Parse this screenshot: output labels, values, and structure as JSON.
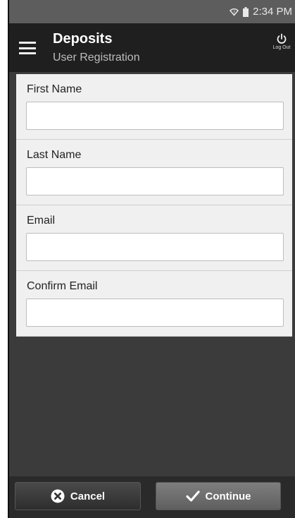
{
  "status_bar": {
    "time": "2:34 PM",
    "icons": [
      "wifi-icon",
      "battery-icon"
    ]
  },
  "app_bar": {
    "title": "Deposits",
    "subtitle": "User Registration",
    "menu_icon": "hamburger-menu-icon",
    "logout_label": "Log Out",
    "logout_icon": "power-icon"
  },
  "form": {
    "fields": [
      {
        "label": "First Name",
        "value": "",
        "placeholder": ""
      },
      {
        "label": "Last Name",
        "value": "",
        "placeholder": ""
      },
      {
        "label": "Email",
        "value": "",
        "placeholder": ""
      },
      {
        "label": "Confirm Email",
        "value": "",
        "placeholder": ""
      }
    ]
  },
  "actions": {
    "cancel_label": "Cancel",
    "cancel_icon": "close-circle-icon",
    "continue_label": "Continue",
    "continue_icon": "checkmark-icon"
  },
  "colors": {
    "status_bar_bg": "#5d5d5d",
    "app_bar_bg": "#1f1f1f",
    "screen_bg": "#3b3b3b",
    "form_bg": "#f0f0f0"
  }
}
